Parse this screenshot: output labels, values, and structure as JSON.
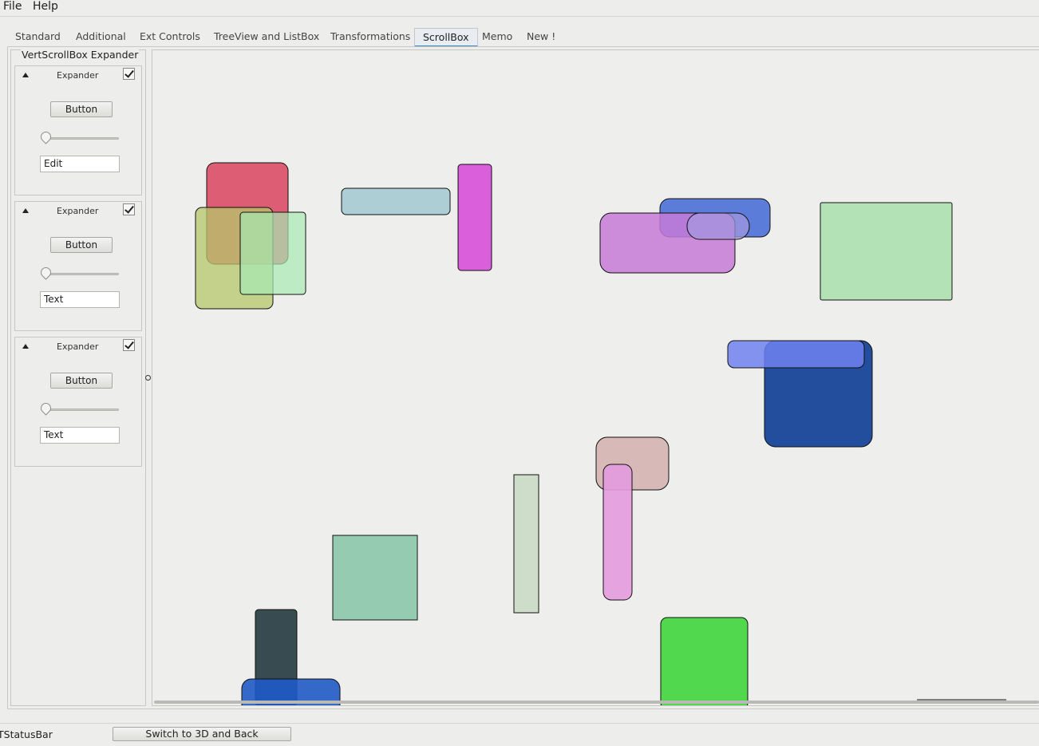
{
  "menu": {
    "items": [
      "File",
      "Help"
    ]
  },
  "tabs": {
    "items": [
      "Standard",
      "Additional",
      "Ext Controls",
      "TreeView and ListBox",
      "Transformations",
      "ScrollBox",
      "Memo",
      "New !"
    ],
    "active": "ScrollBox"
  },
  "left_panel": {
    "title": "VertScrollBox  Expander",
    "expanders": [
      {
        "title": "Expander",
        "checked": true,
        "button": "Button",
        "slider_value": 0,
        "edit": "Edit"
      },
      {
        "title": "Expander",
        "checked": true,
        "button": "Button",
        "slider_value": 0,
        "edit": "Text"
      },
      {
        "title": "Expander",
        "checked": true,
        "button": "Button",
        "slider_value": 0,
        "edit": "Text"
      }
    ]
  },
  "shape_colors": [
    "#d9435f",
    "#b5c76a",
    "#a7e9b4",
    "#a1c8d1",
    "#d650d8",
    "#4b6fd8",
    "#c57ad7",
    "#a79ae0",
    "#aee0b2",
    "#6f81ef",
    "#1f4a9c",
    "#d4b3b1",
    "#e39bde",
    "#cbdac8",
    "#8fc8ae",
    "#34474e",
    "#1f5ac6",
    "#4fd74a"
  ],
  "statusbar": {
    "text": "TStatusBar",
    "button": "Switch to 3D and Back"
  }
}
